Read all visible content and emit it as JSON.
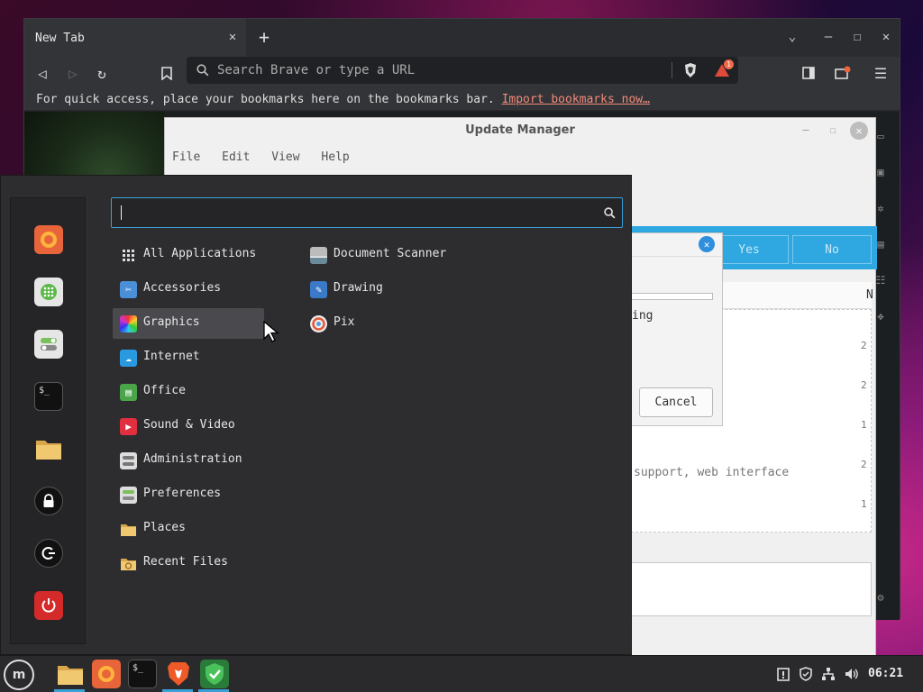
{
  "browser": {
    "tab_title": "New Tab",
    "tab_close": "✕",
    "new_tab": "+",
    "url_placeholder": "Search Brave or type a URL",
    "bookmarks_text": "For quick access, place your bookmarks here on the bookmarks bar.",
    "bookmarks_link": "Import bookmarks now…",
    "shields_badge": "1"
  },
  "update_manager": {
    "title": "Update Manager",
    "menu": [
      "File",
      "Edit",
      "View",
      "Help"
    ],
    "yes_label": "Yes",
    "no_label": "No",
    "list_text": "support, web interface",
    "col_header_partial": "N",
    "row_partials": [
      "2",
      "2",
      "1",
      "2",
      "1"
    ]
  },
  "dialog": {
    "text_partial": "ing",
    "cancel_label": "Cancel"
  },
  "menu": {
    "categories": [
      {
        "label": "All Applications"
      },
      {
        "label": "Accessories"
      },
      {
        "label": "Graphics"
      },
      {
        "label": "Internet"
      },
      {
        "label": "Office"
      },
      {
        "label": "Sound & Video"
      },
      {
        "label": "Administration"
      },
      {
        "label": "Preferences"
      },
      {
        "label": "Places"
      },
      {
        "label": "Recent Files"
      }
    ],
    "selected_category": "Graphics",
    "apps": [
      {
        "label": "Document Scanner"
      },
      {
        "label": "Drawing"
      },
      {
        "label": "Pix"
      }
    ]
  },
  "taskbar": {
    "clock": "06:21"
  },
  "colors": {
    "accent": "#3aa0d8",
    "menu_bg": "#2d2d30",
    "update_blue": "#2fa7e0"
  }
}
